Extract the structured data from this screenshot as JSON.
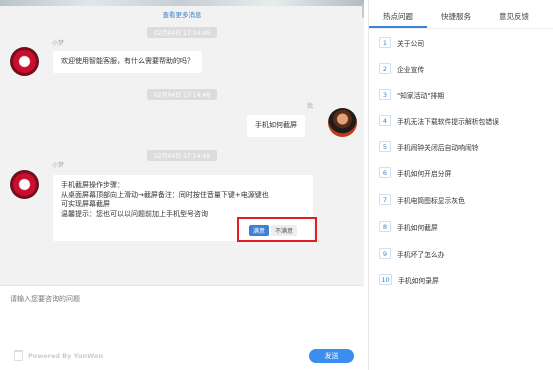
{
  "chat": {
    "load_more": "查看更多消息",
    "messages": [
      {
        "time": "02月04日 17:14:46",
        "sender": "小梦",
        "text": "欢迎使用智能客服，有什么需要帮助的吗？"
      },
      {
        "time": "02月04日 17:14:48",
        "sender": "我",
        "text": "手机如何截屏"
      },
      {
        "time": "02月04日 17:14:48",
        "sender": "小梦",
        "lines": [
          "手机截屏操作步骤：",
          "从桌面屏幕顶部向上滑动→截屏备注：同时按住音量下键+电源键也",
          "可实现屏幕截屏",
          "温馨提示：您也可以以问题前加上手机型号咨询"
        ],
        "feedback": {
          "satisfied": "满意",
          "unsatisfied": "不满意"
        }
      }
    ]
  },
  "input": {
    "placeholder": "请输入您要咨询的问题",
    "powered_by": "Powered By YunWen",
    "send_label": "发送"
  },
  "side_panel": {
    "tabs": [
      "热点问题",
      "快捷服务",
      "意见反馈"
    ],
    "active_tab": 0,
    "questions": [
      {
        "num": "1",
        "text": "关于公司"
      },
      {
        "num": "2",
        "text": "企业宣传"
      },
      {
        "num": "3",
        "text": "\"知家活动\"排期"
      },
      {
        "num": "4",
        "text": "手机无法下载软件提示解析包错误"
      },
      {
        "num": "5",
        "text": "手机闹钟关闭后自动响闹铃"
      },
      {
        "num": "6",
        "text": "手机如何开启分屏"
      },
      {
        "num": "7",
        "text": "手机电筒图标显示灰色"
      },
      {
        "num": "8",
        "text": "手机如何截屏"
      },
      {
        "num": "9",
        "text": "手机坏了怎么办"
      },
      {
        "num": "10",
        "text": "手机如何录屏"
      }
    ]
  },
  "colors": {
    "accent": "#3b82d4",
    "send_button": "#3b8df0",
    "highlight": "#e02020"
  }
}
